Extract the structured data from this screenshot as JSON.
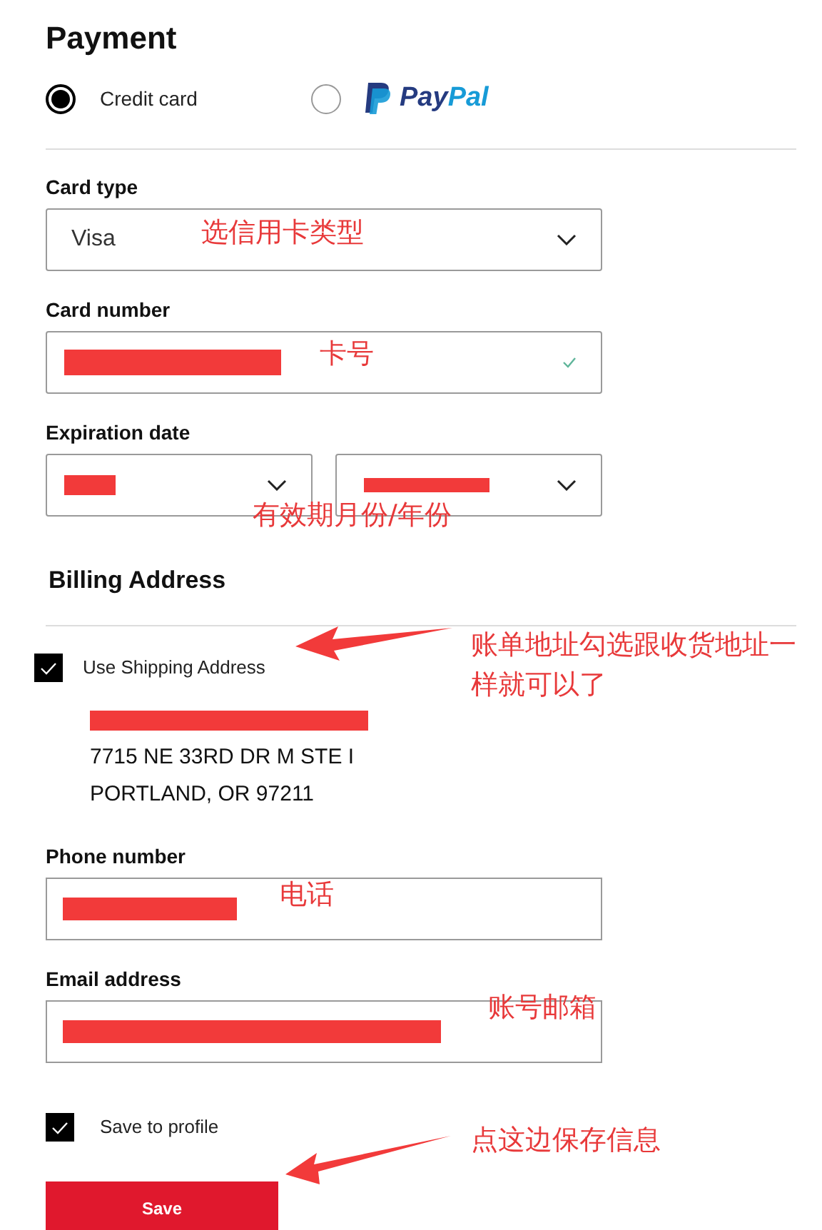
{
  "title": "Payment",
  "payment_methods": [
    {
      "kind": "text",
      "label": "Credit card",
      "selected": true
    },
    {
      "kind": "paypal",
      "label": "PayPal",
      "selected": false
    }
  ],
  "card_fields": [
    {
      "kind": "select",
      "label": "Card type",
      "value": "Visa",
      "note": "选信用卡类型"
    },
    {
      "kind": "input",
      "label": "Card number",
      "valid": true,
      "note": "卡号"
    },
    {
      "kind": "expiry",
      "label": "Expiration date",
      "note": "有效期月份/年份"
    }
  ],
  "billing": {
    "heading": "Billing Address",
    "use_shipping": {
      "label": "Use Shipping Address",
      "checked": true
    },
    "note": "账单地址勾选跟收货地址一样就可以了",
    "address_lines": [
      "7715 NE 33RD DR M STE I",
      "PORTLAND, OR 97211"
    ]
  },
  "contact_fields": [
    {
      "label": "Phone number",
      "note": "电话"
    },
    {
      "label": "Email address",
      "note": "账号邮箱"
    }
  ],
  "save_to_profile": {
    "label": "Save to profile",
    "checked": true
  },
  "save_button": {
    "label": "Save",
    "note": "点这边保存信息"
  }
}
